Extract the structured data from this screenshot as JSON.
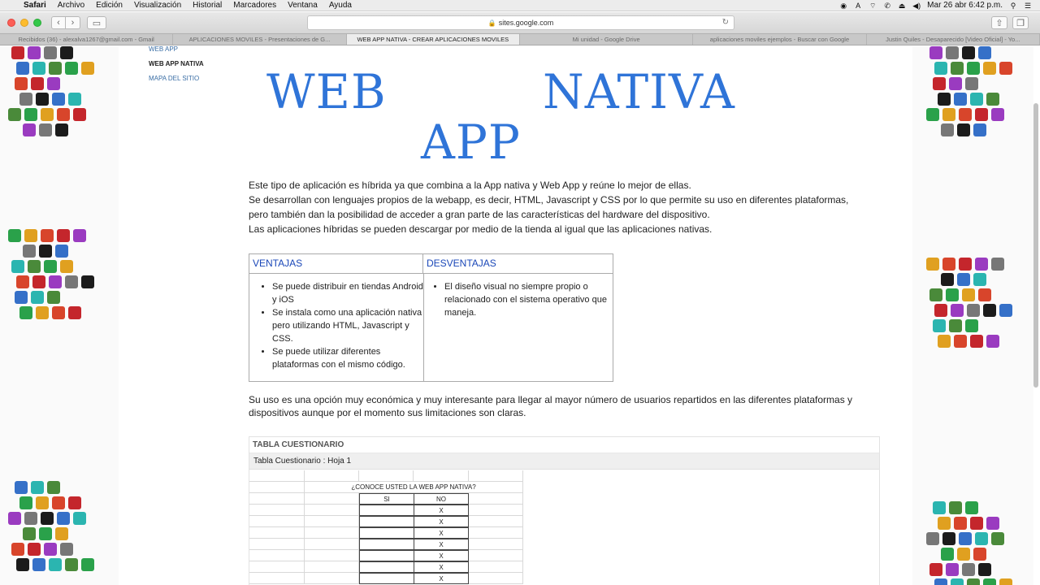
{
  "menubar": {
    "app": "Safari",
    "items": [
      "Archivo",
      "Edición",
      "Visualización",
      "Historial",
      "Marcadores",
      "Ventana",
      "Ayuda"
    ],
    "clock": "Mar 26 abr  6:42 p.m."
  },
  "toolbar": {
    "address": "sites.google.com"
  },
  "tabs": [
    "Recibidos (36) - alexalva1267@gmail.com - Gmail",
    "APLICACIONES MOVILES - Presentaciones de G...",
    "WEB APP NATIVA - CREAR APLICACIONES MOVILES",
    "Mi unidad - Google Drive",
    "aplicaciones moviles ejemplos - Buscar con Google",
    "Justin Quiles - Desaparecido [Video Oficial] - Yo..."
  ],
  "site_nav": {
    "items": [
      "WEB APP",
      "WEB APP NATIVA",
      "MAPA DEL SITIO"
    ]
  },
  "page": {
    "title_web": "WEB",
    "title_nativa": "NATIVA",
    "title_app": "APP",
    "intro": [
      "Este tipo de aplicación es híbrida ya que combina a la App nativa y Web App y reúne lo mejor de ellas.",
      "Se desarrollan con lenguajes propios de la webapp, es decir, HTML, Javascript y CSS por lo que permite su uso en diferentes plataformas,",
      "pero también dan la posibilidad de acceder a gran parte de las características del hardware del dispositivo.",
      "Las aplicaciones híbridas se pueden descargar por medio de la tienda al igual que las aplicaciones nativas."
    ],
    "table": {
      "header_ventajas": "VENTAJAS",
      "header_desventajas": "DESVENTAJAS",
      "ventajas": [
        "Se puede distribuir en tiendas Android y iOS",
        "Se instala como una aplicación nativa pero utilizando HTML, Javascript y CSS.",
        "Se puede utilizar diferentes plataformas con el mismo código."
      ],
      "desventajas": [
        "El diseño visual no siempre propio o relacionado con el sistema operativo que maneja."
      ]
    },
    "conclusion": [
      "Su uso es una opción muy económica y muy interesante para llegar al mayor número de usuarios repartidos en las diferentes plataformas y",
      "dispositivos aunque por el momento sus limitaciones son claras."
    ],
    "questionnaire": {
      "title": "TABLA CUESTIONARIO",
      "sheet_label": "Tabla Cuestionario : Hoja 1",
      "question": "¿CONOCE USTED LA WEB APP NATIVA?",
      "col_si": "SI",
      "col_no": "NO",
      "no_marks": [
        "X",
        "X",
        "X",
        "X",
        "X",
        "X",
        "X"
      ]
    }
  },
  "colors": {
    "title": "#2f74d8",
    "table_header": "#1a47b8",
    "nav_link": "#3a6ea5"
  }
}
